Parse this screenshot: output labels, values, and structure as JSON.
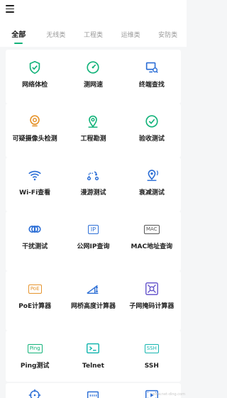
{
  "tabs": [
    {
      "label": "全部",
      "active": true
    },
    {
      "label": "无线类"
    },
    {
      "label": "工程类"
    },
    {
      "label": "运维类"
    },
    {
      "label": "安防类"
    }
  ],
  "colors": {
    "green": "#13b37a",
    "blue": "#2d6fd6",
    "orange": "#e6942d",
    "purple": "#6a5acd",
    "teal": "#17b6b0"
  },
  "tools": [
    {
      "label": "网络体检",
      "icon": "shield-check-icon"
    },
    {
      "label": "测网速",
      "icon": "speedometer-icon"
    },
    {
      "label": "终端查找",
      "icon": "terminal-find-icon"
    },
    {
      "label": "可疑摄像头检测",
      "icon": "camera-icon"
    },
    {
      "label": "工程勘测",
      "icon": "map-pin-icon"
    },
    {
      "label": "验收测试",
      "icon": "check-circle-icon"
    },
    {
      "label": "Wi-Fi查看",
      "icon": "wifi-icon"
    },
    {
      "label": "漫游测试",
      "icon": "roaming-icon"
    },
    {
      "label": "衰减测试",
      "icon": "attenuation-icon"
    },
    {
      "label": "干扰测试",
      "icon": "interference-icon"
    },
    {
      "label": "公网IP查询",
      "icon": "ip-icon",
      "badge": "IP"
    },
    {
      "label": "MAC地址查询",
      "icon": "mac-icon",
      "badge": "MAC"
    },
    {
      "label": "PoE计算器",
      "icon": "poe-icon",
      "badge": "PoE"
    },
    {
      "label": "网桥高度计算器",
      "icon": "bridge-height-icon"
    },
    {
      "label": "子网掩码计算器",
      "icon": "subnet-icon"
    },
    {
      "label": "Ping测试",
      "icon": "ping-icon",
      "badge": "Ping"
    },
    {
      "label": "Telnet",
      "icon": "telnet-icon"
    },
    {
      "label": "SSH",
      "icon": "ssh-icon",
      "badge": "SSH"
    },
    {
      "label": "",
      "icon": "crosshair-icon"
    },
    {
      "label": "",
      "icon": "port-icon"
    },
    {
      "label": "",
      "icon": "film-icon"
    }
  ],
  "watermark": "www.net-ding.com"
}
